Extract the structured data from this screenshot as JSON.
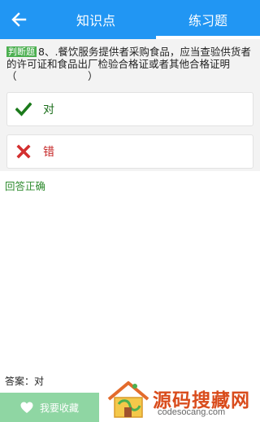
{
  "header": {
    "tabs": [
      {
        "label": "知识点"
      },
      {
        "label": "练习题",
        "active": true
      }
    ]
  },
  "question": {
    "badge": "判断题",
    "text": "8、.餐饮服务提供者采购食品，应当查验供货者的许可证和食品出厂检验合格证或者其他合格证明（　　　　　　　）"
  },
  "options": [
    {
      "label": "对",
      "icon": "check-icon"
    },
    {
      "label": "错",
      "icon": "cross-icon"
    }
  ],
  "result": "回答正确",
  "answer": "答案：对",
  "footer": {
    "favorite_label": "我要收藏"
  },
  "watermark": {
    "title": "源码搜藏网",
    "subtitle": "codesocang.com"
  },
  "colors": {
    "header": "#2196F3",
    "badge": "#4CAF50",
    "correct": "#2e8b2e",
    "wrong": "#c62828",
    "favorite_bar": "#8fd6a3"
  }
}
